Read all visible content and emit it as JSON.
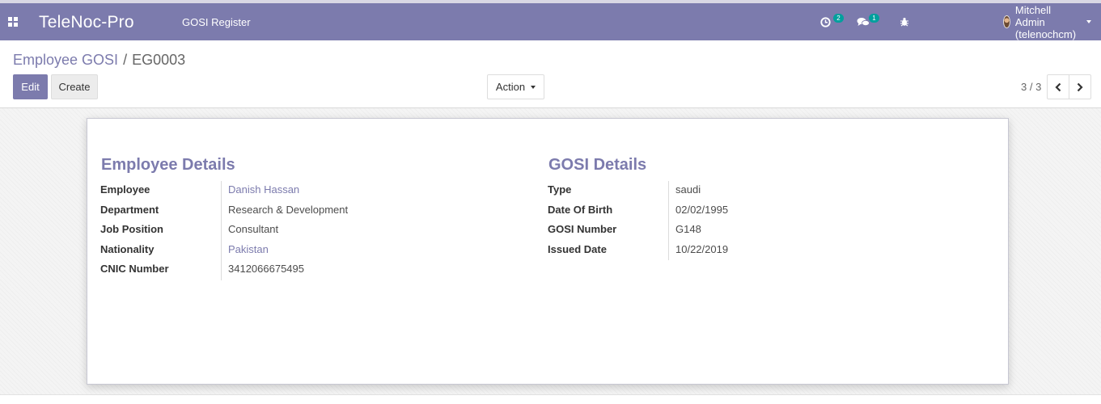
{
  "navbar": {
    "brand": "TeleNoc-Pro",
    "menu": "GOSI Register",
    "activity_count": "2",
    "messages_count": "1",
    "user_name": "Mitchell Admin (telenochcm)"
  },
  "breadcrumb": {
    "parent": "Employee GOSI",
    "separator": "/",
    "current": "EG0003"
  },
  "buttons": {
    "edit": "Edit",
    "create": "Create",
    "action": "Action"
  },
  "pager": {
    "value": "3 / 3"
  },
  "form": {
    "employee_details": {
      "title": "Employee Details",
      "fields": [
        {
          "label": "Employee",
          "value": "Danish Hassan"
        },
        {
          "label": "Department",
          "value": "Research & Development"
        },
        {
          "label": "Job Position",
          "value": "Consultant"
        },
        {
          "label": "Nationality",
          "value": "Pakistan"
        },
        {
          "label": "CNIC Number",
          "value": "3412066675495"
        }
      ]
    },
    "gosi_details": {
      "title": "GOSI Details",
      "fields": [
        {
          "label": "Type",
          "value": "saudi"
        },
        {
          "label": "Date Of Birth",
          "value": "02/02/1995"
        },
        {
          "label": "GOSI Number",
          "value": "G148"
        },
        {
          "label": "Issued Date",
          "value": "10/22/2019"
        }
      ]
    }
  },
  "colors": {
    "brand": "#7c7bad",
    "badge": "#00a09d"
  }
}
